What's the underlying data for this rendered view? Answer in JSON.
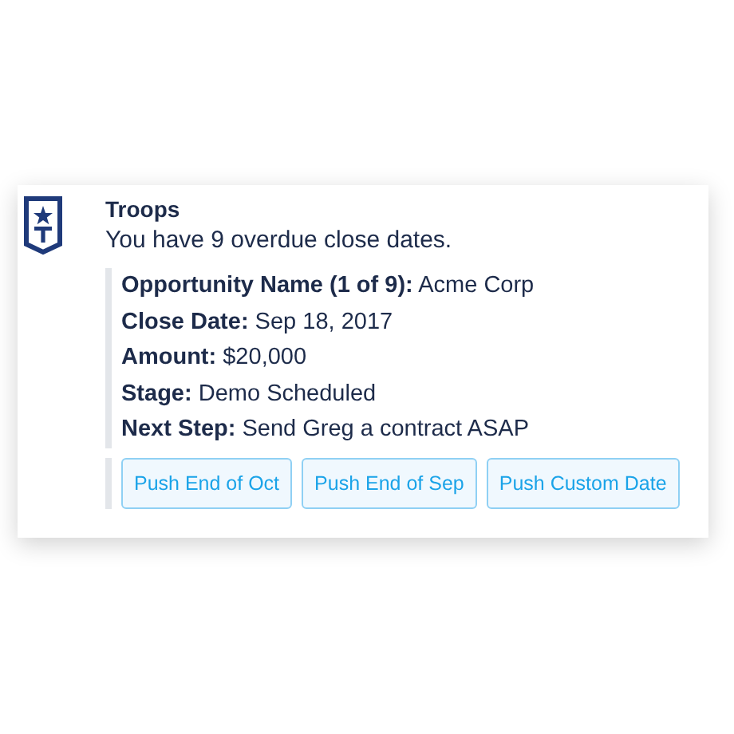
{
  "message": {
    "sender": "Troops",
    "text": "You have 9 overdue close dates.",
    "fields": [
      "**Opportunity Name (1 of 9):** Acme Corp",
      "**Close Date:** Sep 18, 2017",
      "**Amount:** $20,000",
      "**Stage:** Demo Scheduled",
      "**Next Step:** Send Greg a contract ASAP"
    ],
    "buttons": [
      "Push End of Oct",
      "Push End of Sep",
      "Push Custom Date"
    ]
  }
}
